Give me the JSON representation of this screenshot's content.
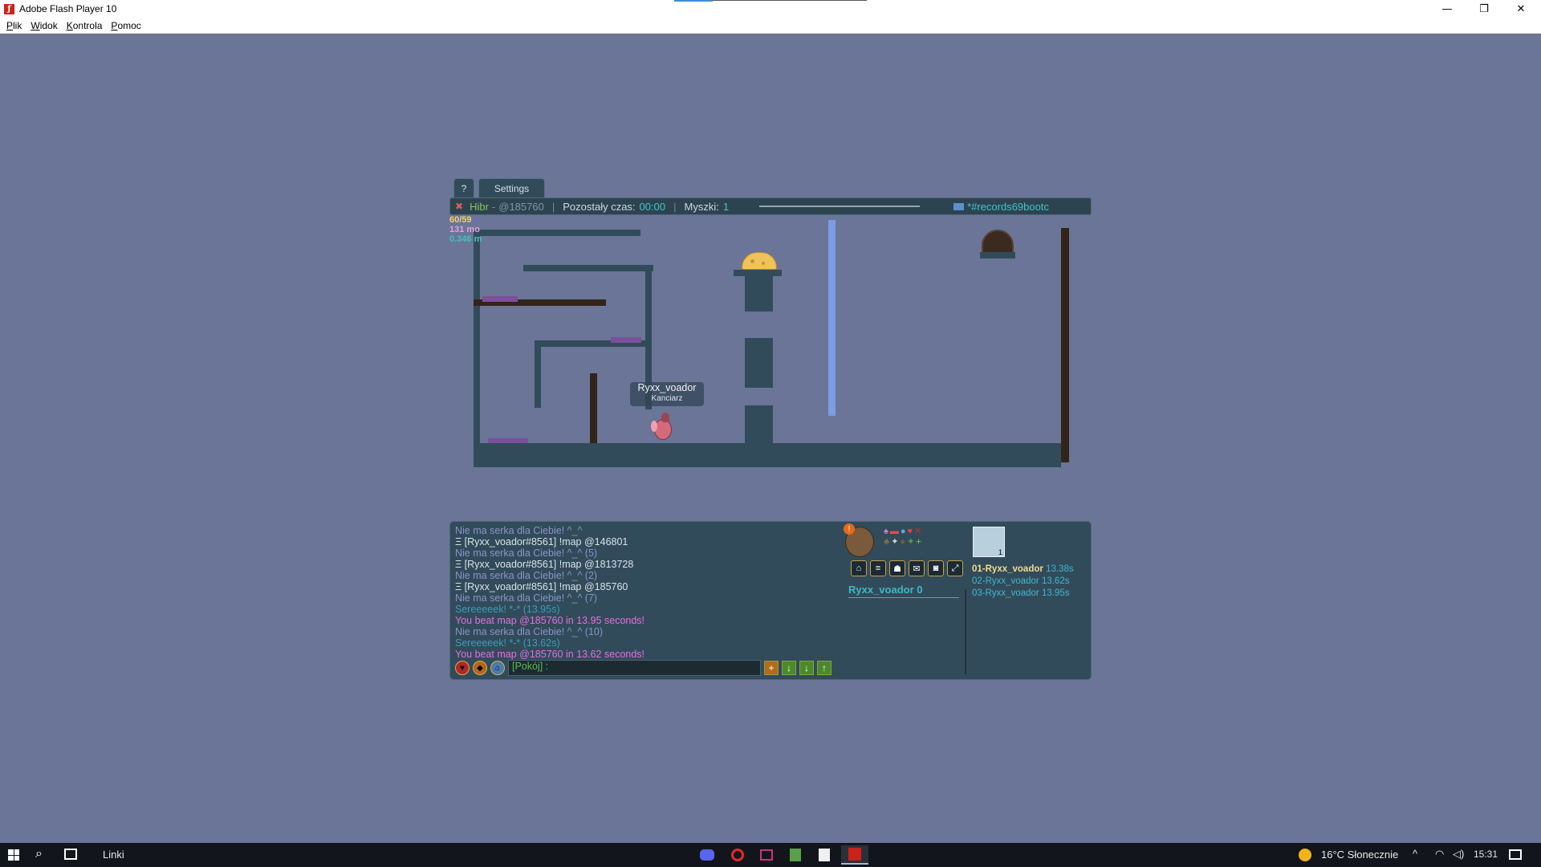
{
  "window": {
    "title": "Adobe Flash Player 10",
    "minimize_label": "—",
    "maximize_label": "❐",
    "close_label": "✕"
  },
  "menu": {
    "items": [
      "Plik",
      "Widok",
      "Kontrola",
      "Pomoc"
    ]
  },
  "game": {
    "tabs": {
      "help_label": "?",
      "settings_label": "Settings"
    },
    "topbar": {
      "author": "Hibr",
      "map_code": "@185760",
      "time_label": "Pozostały czas:",
      "time_value": "00:00",
      "mice_label": "Myszki:",
      "mice_value": "1",
      "room": "*#records69bootc"
    },
    "stats": {
      "fps": "60/59",
      "memory": "131 mo",
      "ping": "0.346 m"
    },
    "player": {
      "name": "Ryxx_voador",
      "title": "Kanciarz"
    },
    "chat": {
      "messages": [
        {
          "text": "Nie ma serka dla Ciebie! ^_^",
          "style": "grey"
        },
        {
          "text": "Ξ [Ryxx_voador#8561] !map @146801",
          "style": "white"
        },
        {
          "text": "Nie ma serka dla Ciebie! ^_^ (5)",
          "style": "grey"
        },
        {
          "text": "Ξ [Ryxx_voador#8561] !map @1813728",
          "style": "white"
        },
        {
          "text": "Nie ma serka dla Ciebie! ^_^ (2)",
          "style": "grey"
        },
        {
          "text": "Ξ [Ryxx_voador#8561] !map @185760",
          "style": "white"
        },
        {
          "text": "Nie ma serka dla Ciebie! ^_^ (7)",
          "style": "grey"
        },
        {
          "text": "Sereeeeek! *-* (13.95s)",
          "style": "cyan"
        },
        {
          "text": "You beat map @185760 in 13.95 seconds!",
          "style": "pink"
        },
        {
          "text": "Nie ma serka dla Ciebie! ^_^ (10)",
          "style": "grey"
        },
        {
          "text": "Sereeeeek! *-* (13.62s)",
          "style": "cyan"
        },
        {
          "text": "You beat map @185760 in 13.62 seconds!",
          "style": "pink"
        }
      ],
      "input_prefix": "[Pokój] :"
    },
    "player_score": "Ryxx_voador 0",
    "ranking": [
      {
        "name": "01-Ryxx_voador",
        "time": "13.38s"
      },
      {
        "name": "02-Ryxx_voador",
        "time": "13.62s"
      },
      {
        "name": "03-Ryxx_voador",
        "time": "13.95s"
      }
    ],
    "map_thumb_count": "1"
  },
  "taskbar": {
    "links_label": "Linki",
    "weather": "16°C Słonecznie",
    "time": "15:31"
  },
  "colors": {
    "background": "#6a7597",
    "platform": "#324b5a",
    "wood": "#33241a",
    "water": "#7e9ce3"
  }
}
